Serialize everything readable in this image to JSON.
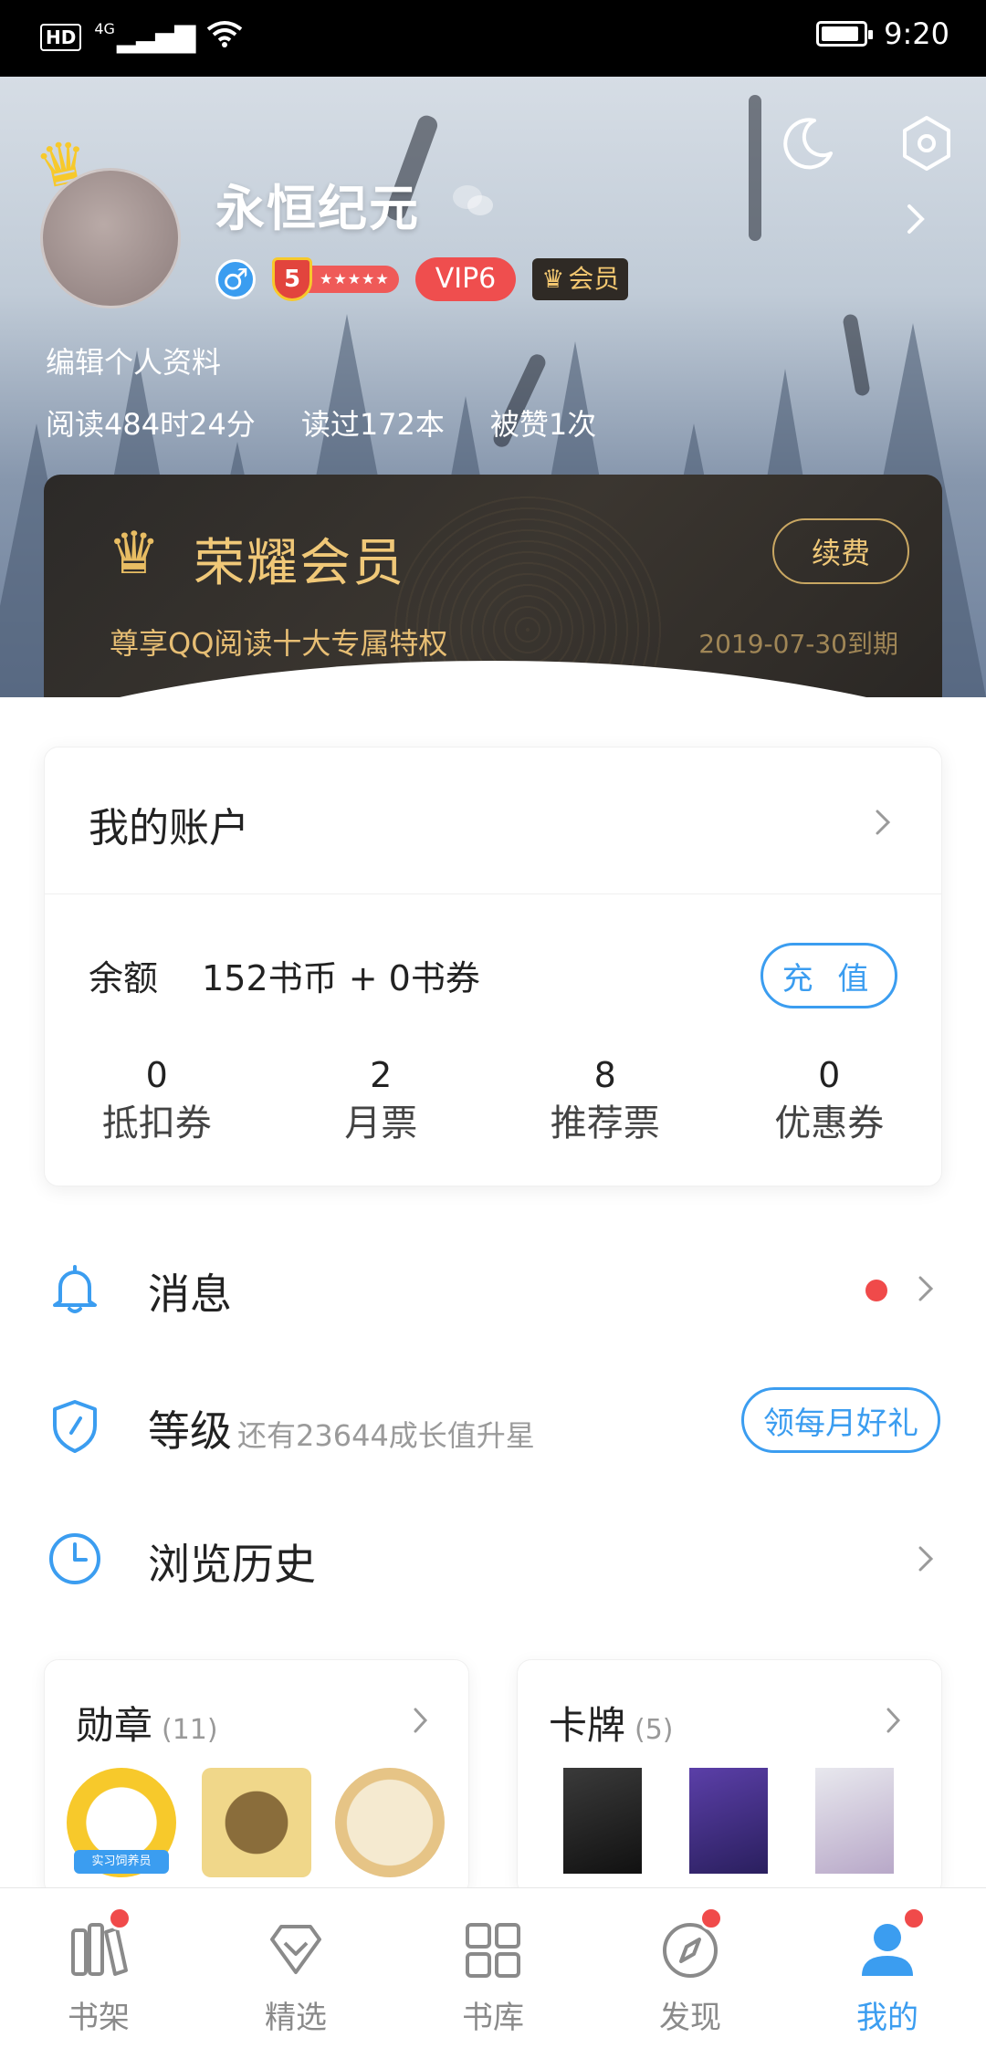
{
  "status_bar": {
    "hd": "HD",
    "network": "4G",
    "time": "9:20"
  },
  "profile": {
    "username": "永恒纪元",
    "level_number": "5",
    "level_stars": "★★★★★",
    "vip_level": "VIP6",
    "member_tag": "会员",
    "edit_label": "编辑个人资料",
    "stats": [
      "阅读484时24分",
      "读过172本",
      "被赞1次"
    ]
  },
  "vip_card": {
    "title": "荣耀会员",
    "renew_label": "续费",
    "description": "尊享QQ阅读十大专属特权",
    "expire": "2019-07-30到期"
  },
  "account": {
    "title": "我的账户",
    "balance_label": "余额",
    "balance_value": "152书币 + 0书券",
    "recharge_label": "充 值",
    "tickets": [
      {
        "value": "0",
        "label": "抵扣券"
      },
      {
        "value": "2",
        "label": "月票"
      },
      {
        "value": "8",
        "label": "推荐票"
      },
      {
        "value": "0",
        "label": "优惠券"
      }
    ]
  },
  "menu": {
    "messages": {
      "label": "消息",
      "icon": "bell-icon"
    },
    "level": {
      "label": "等级",
      "sub": "还有23644成长值升星",
      "button": "领每月好礼",
      "icon": "shield-icon"
    },
    "history": {
      "label": "浏览历史",
      "icon": "clock-icon"
    }
  },
  "medals": {
    "title": "勋章",
    "count": "(11)",
    "items": [
      "实习饲养员"
    ]
  },
  "cards": {
    "title": "卡牌",
    "count": "(5)"
  },
  "bottom_nav": [
    {
      "label": "书架",
      "icon": "bookshelf-icon",
      "badge": true
    },
    {
      "label": "精选",
      "icon": "diamond-icon",
      "badge": false
    },
    {
      "label": "书库",
      "icon": "grid-icon",
      "badge": false
    },
    {
      "label": "发现",
      "icon": "compass-icon",
      "badge": true
    },
    {
      "label": "我的",
      "icon": "user-icon",
      "badge": true,
      "active": true
    }
  ],
  "colors": {
    "accent": "#3b9df0",
    "vip_gold": "#f0c878",
    "alert_red": "#f04a4a"
  }
}
